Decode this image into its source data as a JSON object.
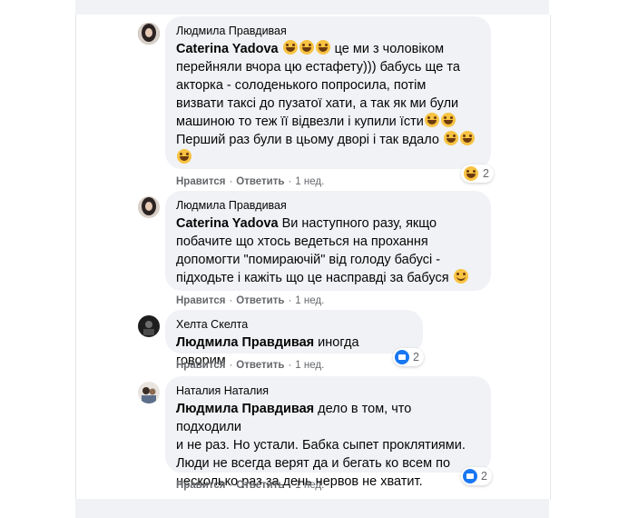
{
  "comments": [
    {
      "author": "Людмила Правдивая",
      "mention": "Caterina Yadova",
      "lines": [
        " це ми з чоловіком",
        "перейняли вчора цю естафету))) бабусь ще та",
        "акторка - солоденького попросила, потім",
        "визвати таксі до пузатої хати, а так як ми були",
        "машиною то теж її відвезли і купили їсти",
        "Перший раз були в цьому дворі і так вдало"
      ],
      "like_label": "Нравится",
      "reply_label": "Ответить",
      "time": "1 нед.",
      "reaction_count": "2",
      "reaction_icon": "laugh-emoji-icon"
    },
    {
      "author": "Людмила Правдивая",
      "mention": "Caterina Yadova",
      "lines": [
        " Ви наступного разу, якщо",
        "побачите що хтось ведеться на прохання",
        "допомогти \"помираючій\" від голоду бабусі -",
        "підходьте і кажіть що це насправді за бабуся"
      ],
      "like_label": "Нравится",
      "reply_label": "Ответить",
      "time": "1 нед."
    },
    {
      "author": "Хелта Скелта",
      "mention": "Людмила Правдивая",
      "lines": [
        " иногда говорим"
      ],
      "like_label": "Нравится",
      "reply_label": "Ответить",
      "time": "1 нед.",
      "reaction_count": "2",
      "reaction_icon": "like-icon"
    },
    {
      "author": "Наталия Наталия",
      "mention": "Людмила Правдивая",
      "lines": [
        " дело в том, что подходили",
        "и не раз. Но устали. Бабка сыпет проклятиями.",
        "Люди не всегда верят да и бегать ко всем по",
        "несколько раз за день нервов не хватит."
      ],
      "like_label": "Нравится",
      "reply_label": "Ответить",
      "time": "1 нед.",
      "reaction_count": "2",
      "reaction_icon": "like-icon"
    },
    {
      "like_label": "Нравится",
      "reply_label": "Ответить",
      "time": "1 нед."
    }
  ],
  "separator": "·",
  "colors": {
    "bubble": "#f0f2f5",
    "meta": "#65676b",
    "like_blue": "#1877f2",
    "emoji_yellow": "#f7c342"
  }
}
